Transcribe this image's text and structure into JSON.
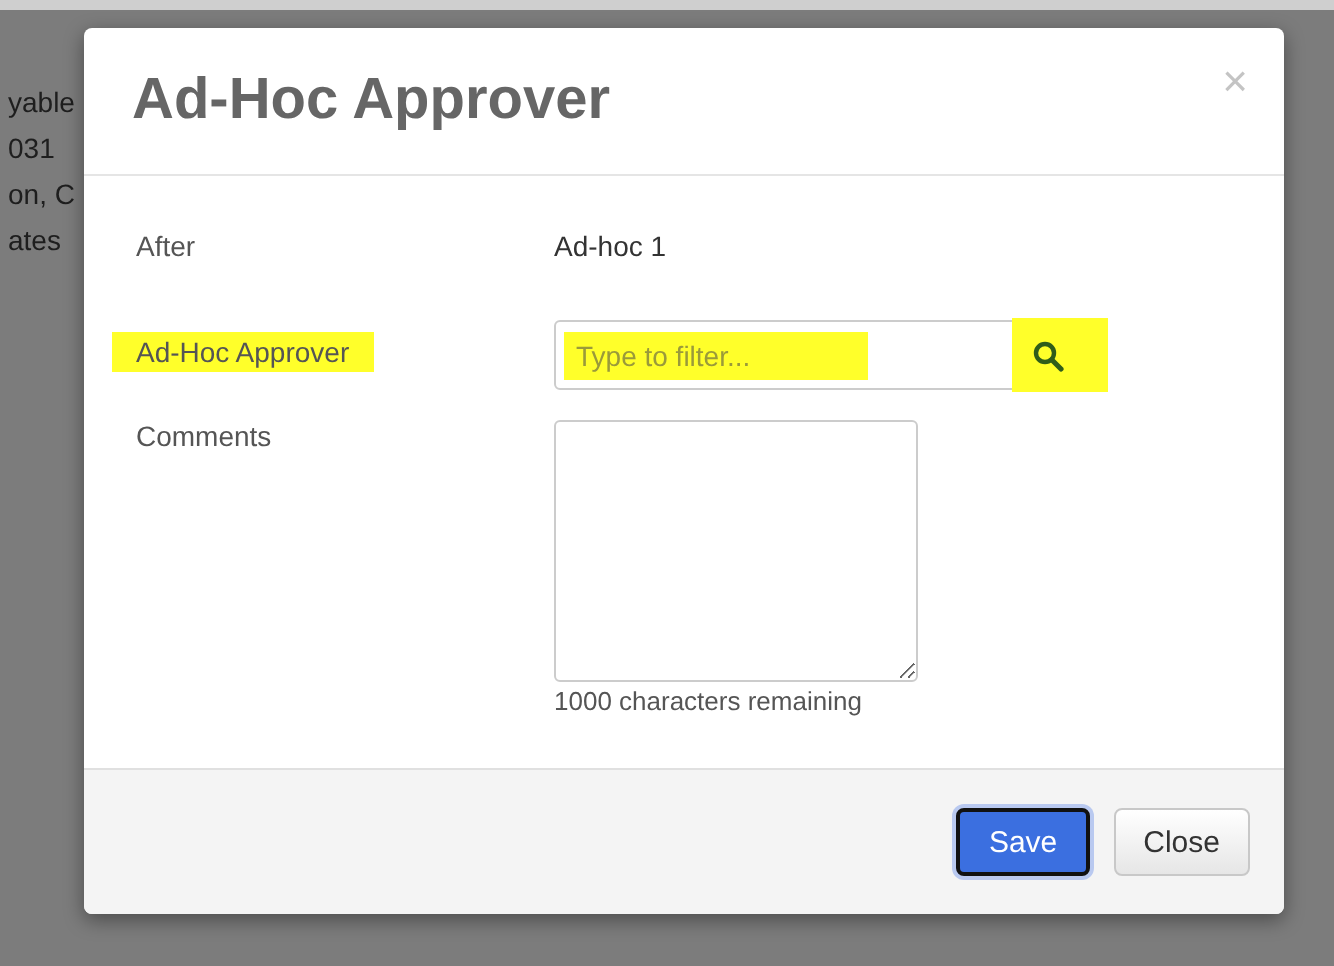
{
  "background_page": {
    "lines": [
      "yable",
      "031",
      "on, C",
      "ates"
    ]
  },
  "dialog": {
    "title": "Ad-Hoc Approver",
    "close_icon": "×",
    "fields": [
      {
        "kind": "text",
        "label": "After",
        "value": "Ad-hoc 1",
        "highlighted": false
      },
      {
        "kind": "search",
        "label": "Ad-Hoc Approver",
        "placeholder": "Type to filter...",
        "highlighted": true
      },
      {
        "kind": "textarea",
        "label": "Comments",
        "helper": "1000 characters remaining",
        "highlighted": false
      }
    ],
    "buttons": [
      {
        "label": "Save",
        "primary": true
      },
      {
        "label": "Close",
        "primary": false
      }
    ]
  }
}
